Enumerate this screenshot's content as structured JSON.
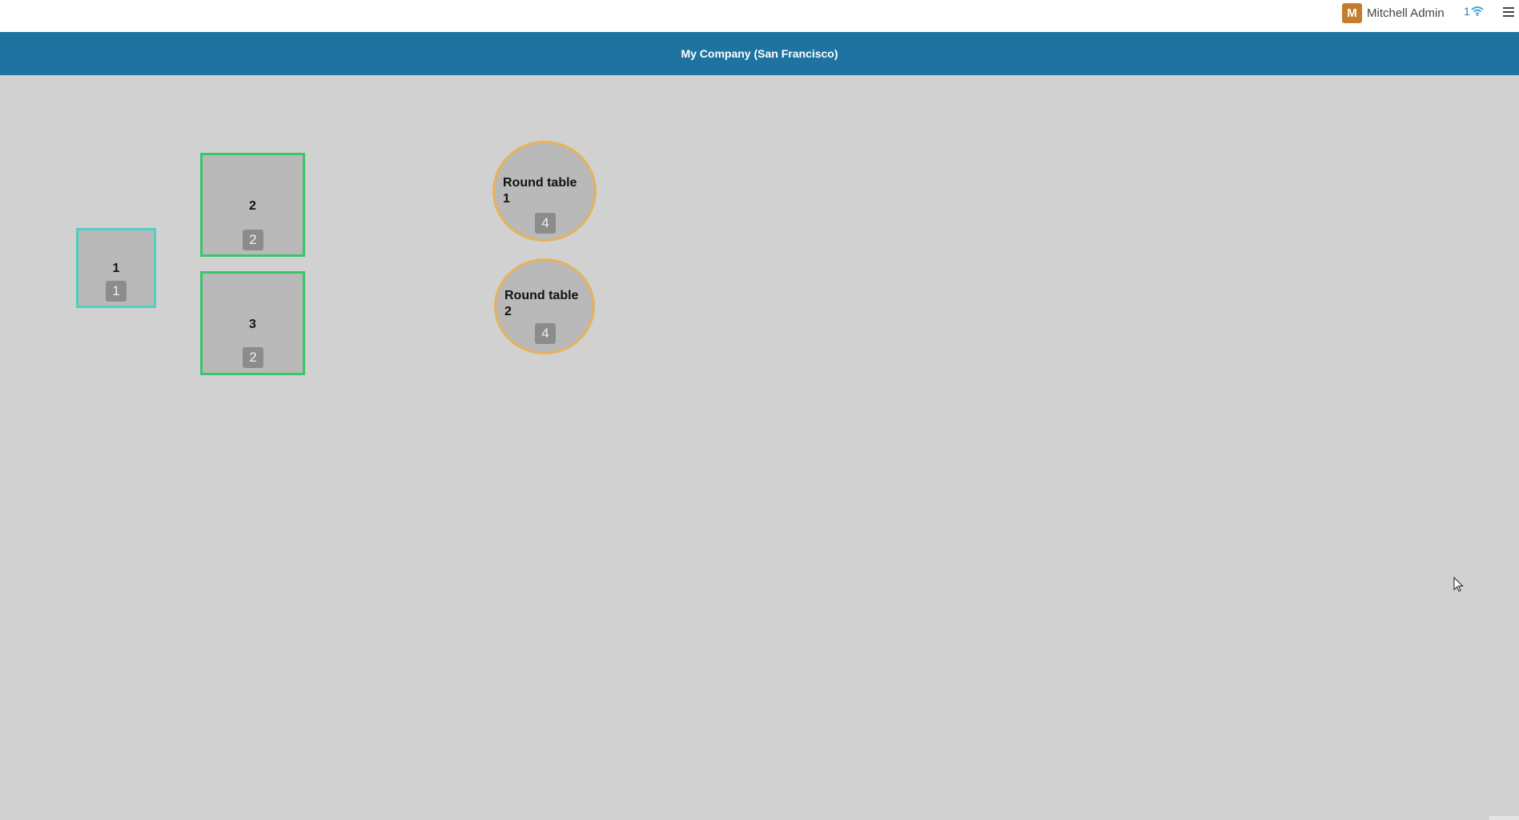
{
  "topbar": {
    "user": {
      "avatar_initial": "M",
      "name": "Mitchell Admin"
    },
    "sync": {
      "count": "1",
      "icon": "wifi-icon"
    },
    "menu_icon": "hamburger-icon"
  },
  "header": {
    "title": "My Company (San Francisco)"
  },
  "floor": {
    "tables": [
      {
        "name": "1",
        "seats": "1",
        "shape": "square"
      },
      {
        "name": "2",
        "seats": "2",
        "shape": "square"
      },
      {
        "name": "3",
        "seats": "2",
        "shape": "square"
      },
      {
        "name": "Round table 1",
        "seats": "4",
        "shape": "round"
      },
      {
        "name": "Round table 2",
        "seats": "4",
        "shape": "round"
      }
    ]
  },
  "colors": {
    "header_bg": "#1f73a0",
    "floor_bg": "#d1d1d1",
    "table_bg": "#b9b9b9",
    "square_border": "#3cc46a",
    "selected_border": "#4cd0c0",
    "round_border": "#e4b35b",
    "avatar_bg": "#c67c2d"
  }
}
